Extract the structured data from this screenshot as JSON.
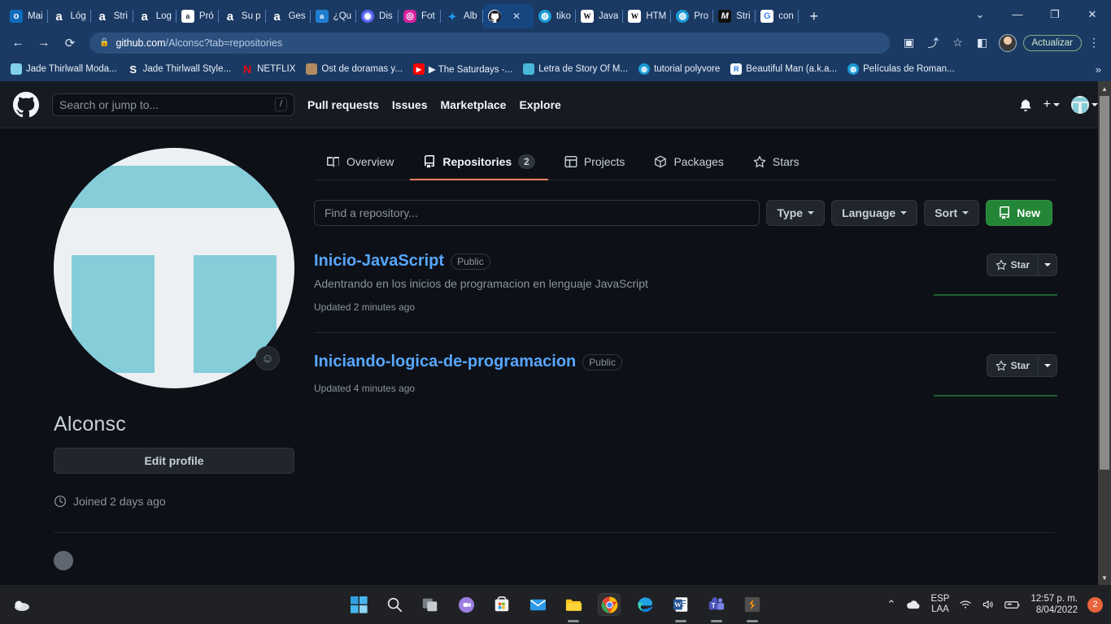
{
  "browser": {
    "tabs": [
      {
        "title": "Mai",
        "icon": "outlook-icon",
        "favclass": "fav-outlook",
        "glyph": "o",
        "active": false
      },
      {
        "title": "Lóg",
        "icon": "amazon-icon",
        "favclass": "fav-amazon",
        "glyph": "a",
        "active": false
      },
      {
        "title": "Stri",
        "icon": "amazon-icon",
        "favclass": "fav-amazon",
        "glyph": "a",
        "active": false
      },
      {
        "title": "Log",
        "icon": "amazon-icon",
        "favclass": "fav-amazon",
        "glyph": "a",
        "active": false
      },
      {
        "title": "Pró",
        "icon": "amazon-box-icon",
        "favclass": "fav-amazonbox",
        "glyph": "a",
        "active": false
      },
      {
        "title": "Su p",
        "icon": "amazon-icon",
        "favclass": "fav-amazon",
        "glyph": "a",
        "active": false
      },
      {
        "title": "Ges",
        "icon": "amazon-icon",
        "favclass": "fav-amazon",
        "glyph": "a",
        "active": false
      },
      {
        "title": "¿Qu",
        "icon": "amazon-blue-icon",
        "favclass": "fav-amazonblue",
        "glyph": "a",
        "active": false
      },
      {
        "title": "Dis",
        "icon": "discord-icon",
        "favclass": "fav-disc",
        "glyph": "◉",
        "active": false
      },
      {
        "title": "Fot",
        "icon": "instagram-icon",
        "favclass": "fav-ig",
        "glyph": "◎",
        "active": false
      },
      {
        "title": "Alb",
        "icon": "twitter-icon",
        "favclass": "fav-tw",
        "glyph": "✦",
        "active": false
      },
      {
        "title": "",
        "icon": "github-icon",
        "favclass": "fav-gh",
        "glyph": "",
        "active": true
      },
      {
        "title": "tiko",
        "icon": "globe-icon",
        "favclass": "fav-globe",
        "glyph": "◍",
        "active": false
      },
      {
        "title": "Java",
        "icon": "wikipedia-icon",
        "favclass": "fav-wiki",
        "glyph": "W",
        "active": false
      },
      {
        "title": "HTM",
        "icon": "wikipedia-icon",
        "favclass": "fav-wiki",
        "glyph": "W",
        "active": false
      },
      {
        "title": "Pro",
        "icon": "globe-icon",
        "favclass": "fav-globe",
        "glyph": "◍",
        "active": false
      },
      {
        "title": "Stri",
        "icon": "medium-icon",
        "favclass": "fav-m",
        "glyph": "M",
        "active": false
      },
      {
        "title": "con",
        "icon": "google-icon",
        "favclass": "fav-g",
        "glyph": "G",
        "active": false
      }
    ],
    "new_tab_label": "+",
    "window_controls": {
      "restore_list": "⌄",
      "minimize": "—",
      "maximize": "❐",
      "close": "✕"
    },
    "nav": {
      "back": "←",
      "forward": "→",
      "reload": "⟳",
      "lock": "🔒",
      "url_host": "github.com",
      "url_path": "/Alconsc?tab=repositories",
      "collections": "▣",
      "share": "⤴",
      "favorite": "☆",
      "split_screen": "◧",
      "update_label": "Actualizar",
      "menu": "⋮"
    },
    "bookmarks": [
      {
        "label": "Jade Thirlwall Moda...",
        "icon": "site-icon",
        "cls": "bmi-jade",
        "glyph": ""
      },
      {
        "label": "Jade Thirlwall Style...",
        "icon": "letter-s-icon",
        "cls": "bmi-s",
        "glyph": "S"
      },
      {
        "label": "NETFLIX",
        "icon": "netflix-icon",
        "cls": "bmi-nf",
        "glyph": "N"
      },
      {
        "label": "Ost de doramas y...",
        "icon": "site-icon",
        "cls": "bmi-ost",
        "glyph": ""
      },
      {
        "label": "▶ The Saturdays -...",
        "icon": "youtube-icon",
        "cls": "bmi-yt",
        "glyph": "▶"
      },
      {
        "label": "Letra de Story Of M...",
        "icon": "site-icon",
        "cls": "bmi-letra",
        "glyph": ""
      },
      {
        "label": "tutorial polyvore",
        "icon": "globe-icon",
        "cls": "bmi-globe",
        "glyph": "◍"
      },
      {
        "label": "Beautiful Man (a.k.a...",
        "icon": "letter-r-icon",
        "cls": "bmi-r",
        "glyph": "R"
      },
      {
        "label": "Películas de Roman...",
        "icon": "globe-icon",
        "cls": "bmi-globe",
        "glyph": "◍"
      }
    ],
    "bookmarks_overflow": "»"
  },
  "github": {
    "header": {
      "logo": "github-mark-icon",
      "search_placeholder": "Search or jump to...",
      "search_shortcut": "/",
      "links": [
        "Pull requests",
        "Issues",
        "Marketplace",
        "Explore"
      ],
      "notifications_icon": "bell-icon",
      "plus_icon": "+",
      "avatar": "user-avatar"
    },
    "profile": {
      "username": "Alconsc",
      "edit_profile_label": "Edit profile",
      "joined_icon": "clock-icon",
      "joined_text": "Joined 2 days ago",
      "avatar_emoji_badge": "☺"
    },
    "tabs": [
      {
        "label": "Overview",
        "icon": "book-icon",
        "count": null,
        "selected": false
      },
      {
        "label": "Repositories",
        "icon": "repo-icon",
        "count": "2",
        "selected": true
      },
      {
        "label": "Projects",
        "icon": "project-icon",
        "count": null,
        "selected": false
      },
      {
        "label": "Packages",
        "icon": "package-icon",
        "count": null,
        "selected": false
      },
      {
        "label": "Stars",
        "icon": "star-icon",
        "count": null,
        "selected": false
      }
    ],
    "filters": {
      "find_placeholder": "Find a repository...",
      "type_label": "Type",
      "language_label": "Language",
      "sort_label": "Sort",
      "new_label": "New",
      "new_icon": "repo-icon"
    },
    "repositories": [
      {
        "name": "Inicio-JavaScript",
        "visibility": "Public",
        "description": "Adentrando en los inicios de programacion en lenguaje JavaScript",
        "updated": "Updated 2 minutes ago",
        "star_label": "Star",
        "star_icon": "star-icon",
        "language_color": "#2ea043"
      },
      {
        "name": "Iniciando-logica-de-programacion",
        "visibility": "Public",
        "description": "",
        "updated": "Updated 4 minutes ago",
        "star_label": "Star",
        "star_icon": "star-icon",
        "language_color": "#2ea043"
      }
    ]
  },
  "taskbar": {
    "items": [
      {
        "name": "start-button",
        "icon": "windows-icon",
        "state": ""
      },
      {
        "name": "search-button",
        "icon": "search-icon",
        "state": ""
      },
      {
        "name": "task-view-button",
        "icon": "task-view-icon",
        "state": ""
      },
      {
        "name": "chat-button",
        "icon": "chat-icon",
        "state": ""
      },
      {
        "name": "microsoft-store-button",
        "icon": "store-icon",
        "state": ""
      },
      {
        "name": "mail-button",
        "icon": "mail-icon",
        "state": ""
      },
      {
        "name": "file-explorer-button",
        "icon": "folder-icon",
        "state": "open"
      },
      {
        "name": "chrome-button",
        "icon": "chrome-icon",
        "state": "active"
      },
      {
        "name": "edge-button",
        "icon": "edge-icon",
        "state": ""
      },
      {
        "name": "word-button",
        "icon": "word-icon",
        "state": "open"
      },
      {
        "name": "teams-button",
        "icon": "teams-icon",
        "state": "open"
      },
      {
        "name": "sublime-button",
        "icon": "sublime-icon",
        "state": "open"
      }
    ],
    "tray": {
      "chevron": "⌃",
      "cloud_icon": "onedrive-icon",
      "language_line1": "ESP",
      "language_line2": "LAA",
      "wifi_icon": "wifi-icon",
      "volume_icon": "volume-icon",
      "battery_icon": "battery-icon",
      "time": "12:57 p. m.",
      "date": "8/04/2022",
      "notification_count": "2"
    }
  }
}
